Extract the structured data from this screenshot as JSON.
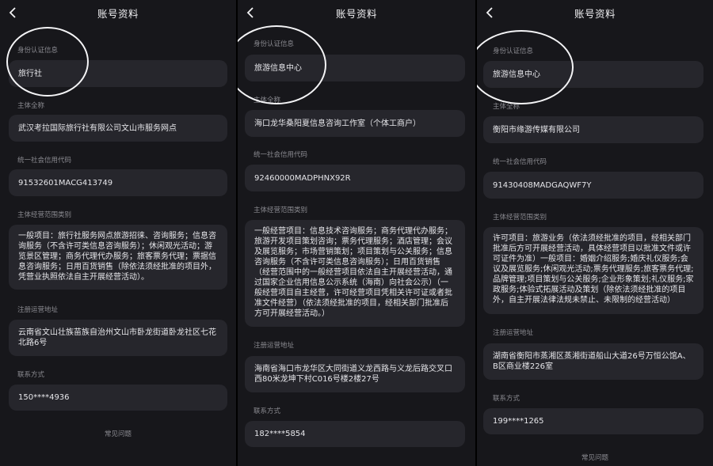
{
  "header_title": "账号资料",
  "labels": {
    "identity": "身份认证信息",
    "entity_name": "主体全称",
    "credit_code": "统一社会信用代码",
    "scope": "主体经营范围类别",
    "address": "注册运营地址",
    "contact": "联系方式"
  },
  "faq": "常见问题",
  "icons": {
    "back": "chevron-left-icon",
    "highlight": "circle-annotation"
  },
  "panels": [
    {
      "identity": "旅行社",
      "entity_name": "武汉考拉国际旅行社有限公司文山市服务网点",
      "credit_code": "91532601MACG413749",
      "scope": "一般项目：旅行社服务网点旅游招徕、咨询服务；信息咨询服务（不含许可类信息咨询服务）；休闲观光活动；游览景区管理；商务代理代办服务；旅客票务代理；票据信息咨询服务；日用百货销售（除依法须经批准的项目外，凭营业执照依法自主开展经营活动）。",
      "address": "云南省文山壮族苗族自治州文山市卧龙街道卧龙社区七花北路6号",
      "contact": "150****4936"
    },
    {
      "identity": "旅游信息中心",
      "entity_name": "海口龙华桑阳夏信息咨询工作室（个体工商户）",
      "credit_code": "92460000MADPHNX92R",
      "scope": "一般经营项目：信息技术咨询服务；商务代理代办服务；旅游开发项目策划咨询；票务代理服务；酒店管理；会议及展览服务；市场营销策划；项目策划与公关服务；信息咨询服务（不含许可类信息咨询服务）；日用百货销售（经营范围中的一般经营项目依法自主开展经营活动，通过国家企业信用信息公示系统（海南）向社会公示）（一般经营项目自主经营，许可经营项目凭相关许可证或者批准文件经营）（依法须经批准的项目，经相关部门批准后方可开展经营活动。）",
      "address": "海南省海口市龙华区大同街道义龙西路与义龙后路交叉口西80米龙坤下村C016号楼2楼27号",
      "contact": "182****5854"
    },
    {
      "identity": "旅游信息中心",
      "entity_name": "衡阳市缘游传媒有限公司",
      "credit_code": "91430408MADGAQWF7Y",
      "scope": "许可项目：旅游业务（依法须经批准的项目，经相关部门批准后方可开展经营活动，具体经营项目以批准文件或许可证件为准）一般项目：婚姻介绍服务;婚庆礼仪服务;会议及展览服务;休闲观光活动;票务代理服务;旅客票务代理;品牌管理;项目策划与公关服务;企业形象策划;礼仪服务;家政服务;体验式拓展活动及策划（除依法须经批准的项目外，自主开展法律法规未禁止、未限制的经营活动）",
      "address": "湖南省衡阳市蒸湘区蒸湘街道船山大道26号万恒公馆A、B区商业楼226室",
      "contact": "199****1265"
    }
  ]
}
